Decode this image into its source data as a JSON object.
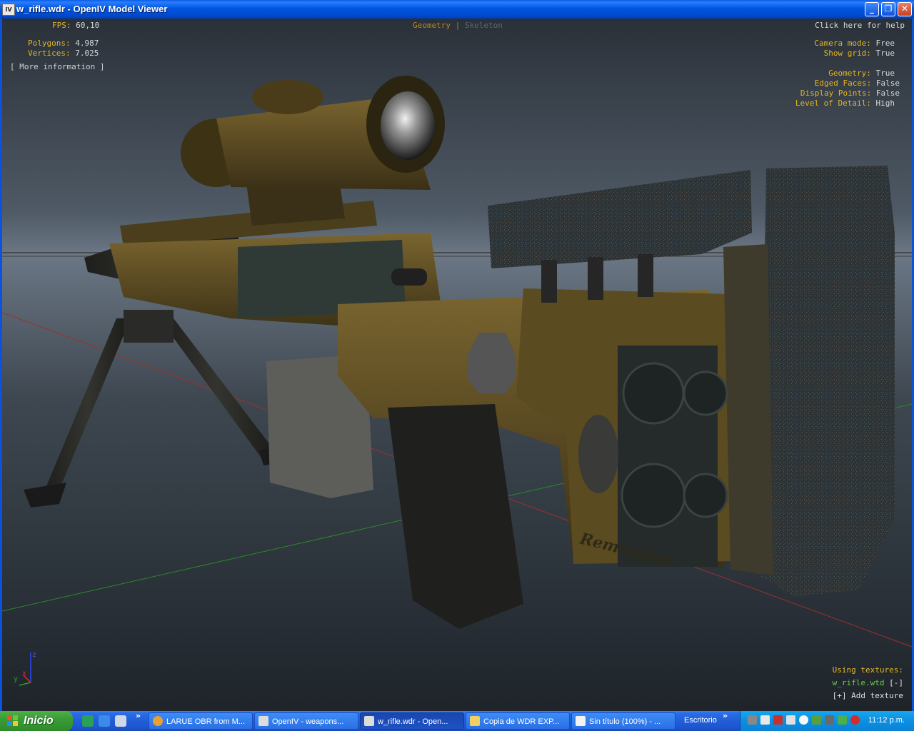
{
  "window": {
    "title": "w_rifle.wdr - OpenIV Model Viewer",
    "app_icon": "IV",
    "buttons": {
      "minimize": "_",
      "maximize": "❐",
      "close": "✕"
    }
  },
  "viewer": {
    "fps_label": "FPS:",
    "fps_value": "60,10",
    "polygons_label": "Polygons:",
    "polygons_value": "4.987",
    "vertices_label": "Vertices:",
    "vertices_value": "7.025",
    "more_info": "[ More information ]",
    "tabs": {
      "geometry": "Geometry",
      "separator": "|",
      "skeleton": "Skeleton"
    },
    "help": "Click here for help",
    "camera_mode_label": "Camera mode:",
    "camera_mode_value": "Free",
    "show_grid_label": "Show grid:",
    "show_grid_value": "True",
    "geometry_label": "Geometry:",
    "geometry_value": "True",
    "edged_faces_label": "Edged Faces:",
    "edged_faces_value": "False",
    "display_points_label": "Display Points:",
    "display_points_value": "False",
    "lod_label": "Level of Detail:",
    "lod_value": "High",
    "axis_z": "z",
    "axis_y": "y",
    "axis_x": "x",
    "using_textures": "Using textures:",
    "texture_file": "w_rifle.wtd",
    "remove_texture": "[-]",
    "add_texture": "[+] Add texture",
    "model_engraving": "Remington"
  },
  "taskbar": {
    "start_label": "Inicio",
    "chevron": "»",
    "tasks": [
      {
        "label": "LARUE OBR from M...",
        "active": false
      },
      {
        "label": "OpenIV - weapons...",
        "active": false
      },
      {
        "label": "w_rifle.wdr - Open...",
        "active": true
      },
      {
        "label": "Copia de WDR EXP...",
        "active": false
      },
      {
        "label": "Sin título (100%) - ...",
        "active": false
      }
    ],
    "desktop_label": "Escritorio",
    "clock": "11:12 p.m."
  },
  "colors": {
    "hud_label": "#e3b622",
    "hud_value": "#d8d8d8",
    "texture_file": "#6ad03a",
    "titlebar": "#0056e0",
    "start_button": "#3a9c36"
  }
}
